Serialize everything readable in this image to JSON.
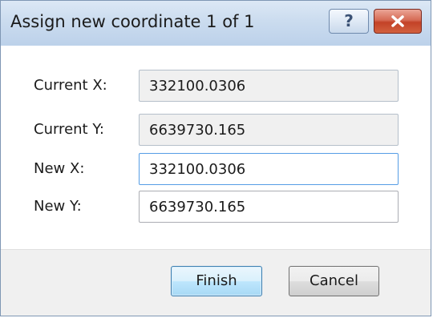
{
  "dialog": {
    "title": "Assign new coordinate 1  of 1",
    "help_label": "?"
  },
  "fields": {
    "current_x": {
      "label": "Current X:",
      "value": "332100.0306"
    },
    "current_y": {
      "label": "Current Y:",
      "value": "6639730.165"
    },
    "new_x": {
      "label": "New X:",
      "value": "332100.0306"
    },
    "new_y": {
      "label": "New Y:",
      "value": "6639730.165"
    }
  },
  "buttons": {
    "finish_label": "Finish",
    "cancel_label": "Cancel"
  },
  "colors": {
    "title_bar": "#c9dbef",
    "close_button": "#c94a30",
    "focus_border": "#569de5",
    "default_button": "#bee6fd"
  },
  "icons": {
    "help": "question-mark-icon",
    "close": "close-icon"
  }
}
